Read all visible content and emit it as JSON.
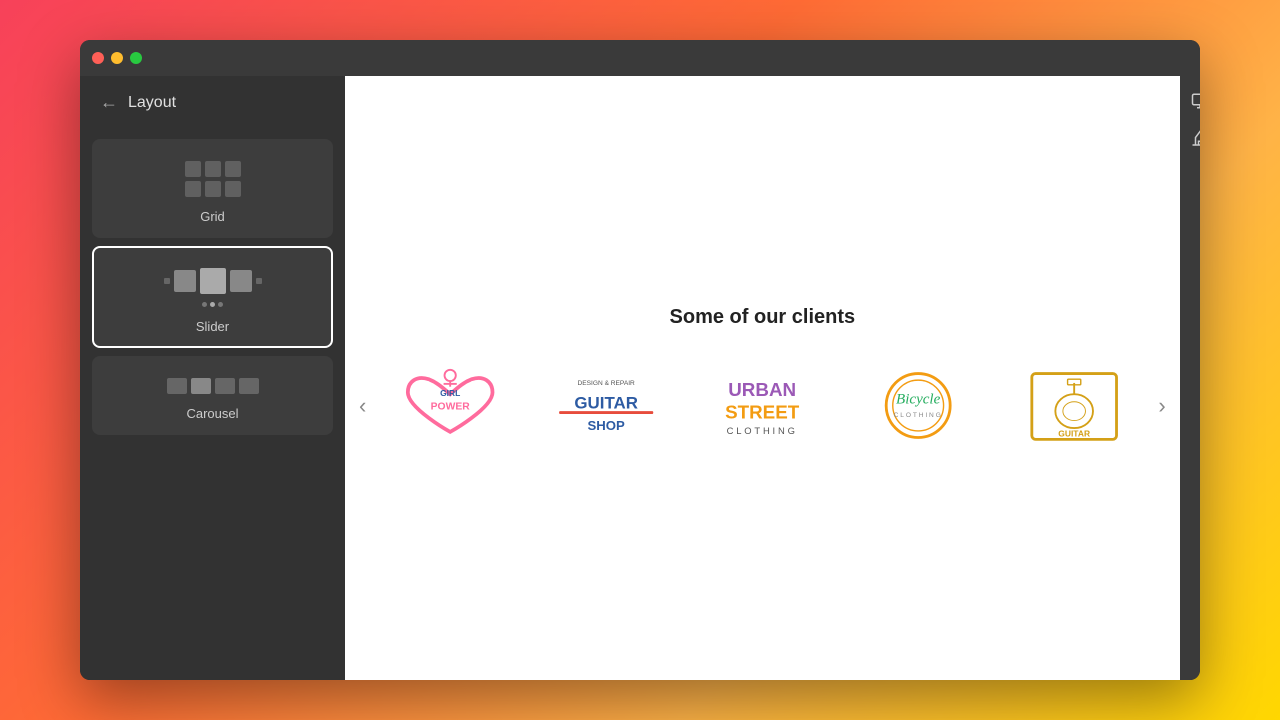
{
  "browser": {
    "traffic_lights": [
      "red",
      "yellow",
      "green"
    ]
  },
  "sidebar": {
    "back_label": "←",
    "title": "Layout",
    "items": [
      {
        "id": "grid",
        "label": "Grid",
        "selected": false,
        "icon": "grid-icon"
      },
      {
        "id": "slider",
        "label": "Slider",
        "selected": true,
        "icon": "slider-icon"
      },
      {
        "id": "carousel",
        "label": "Carousel",
        "selected": false,
        "icon": "carousel-icon"
      }
    ]
  },
  "main": {
    "clients_title": "Some of our clients",
    "carousel_prev": "‹",
    "carousel_next": "›",
    "logos": [
      {
        "name": "Girl Power",
        "description": "Heart shaped logo with Girl Power text"
      },
      {
        "name": "Guitar Shop",
        "description": "Guitar Shop logo with design and repair text"
      },
      {
        "name": "Urban Street Clothing",
        "description": "Urban Street Clothing colorful logo"
      },
      {
        "name": "Bicycle",
        "description": "Bicycle circular logo in orange"
      },
      {
        "name": "Guitar",
        "description": "Guitar logo in yellow box"
      }
    ]
  },
  "right_toolbar": {
    "icons": [
      "monitor-icon",
      "paint-icon"
    ]
  }
}
